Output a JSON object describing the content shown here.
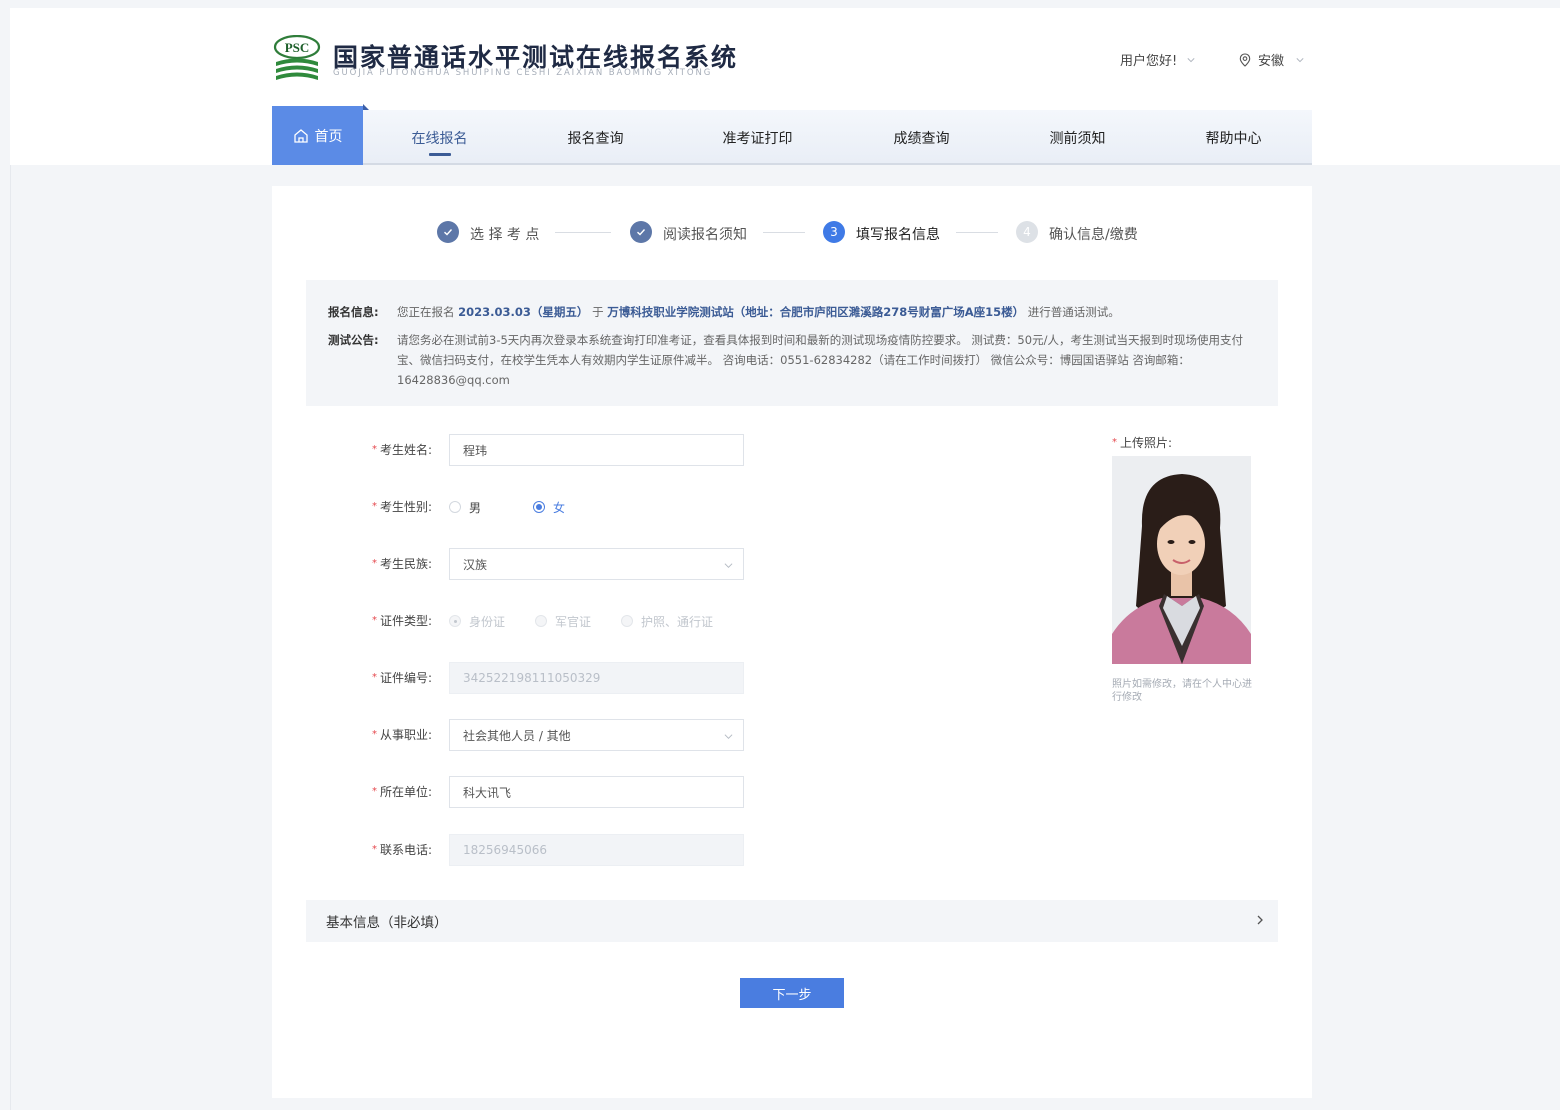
{
  "header": {
    "title": "国家普通话水平测试在线报名系统",
    "subtitle": "GUOJIA PUTONGHUA SHUIPING CESHI ZAIXIAN BAOMING XITONG",
    "logo_text": "PSC",
    "user_greeting": "用户您好!",
    "location": "安徽"
  },
  "nav": {
    "home": "首页",
    "items": [
      "在线报名",
      "报名查询",
      "准考证打印",
      "成绩查询",
      "测前须知",
      "帮助中心"
    ]
  },
  "steps": [
    {
      "label": "选 择 考 点",
      "state": "done"
    },
    {
      "label": "阅读报名须知",
      "state": "done"
    },
    {
      "number": "3",
      "label": "填写报名信息",
      "state": "active"
    },
    {
      "number": "4",
      "label": "确认信息/缴费",
      "state": "pending"
    }
  ],
  "notice": {
    "info_label": "报名信息:",
    "info_prefix": "您正在报名",
    "info_date": "2023.03.03（星期五）",
    "info_mid": "于",
    "info_site": "万博科技职业学院测试站（地址：合肥市庐阳区濉溪路278号财富广场A座15楼）",
    "info_suffix": "进行普通话测试。",
    "announce_label": "测试公告:",
    "announce_text": "请您务必在测试前3-5天内再次登录本系统查询打印准考证，查看具体报到时间和最新的测试现场疫情防控要求。 测试费：50元/人，考生测试当天报到时现场使用支付宝、微信扫码支付，在校学生凭本人有效期内学生证原件减半。 咨询电话：0551-62834282（请在工作时间拨打） 微信公众号：博园国语驿站 咨询邮箱：16428836@qq.com"
  },
  "form": {
    "name_label": "考生姓名:",
    "name_value": "程玮",
    "gender_label": "考生性别:",
    "gender_options": [
      "男",
      "女"
    ],
    "gender_selected": "女",
    "ethnicity_label": "考生民族:",
    "ethnicity_value": "汉族",
    "id_type_label": "证件类型:",
    "id_type_options": [
      "身份证",
      "军官证",
      "护照、通行证"
    ],
    "id_number_label": "证件编号:",
    "id_number_value": "342522198111050329",
    "occupation_label": "从事职业:",
    "occupation_value": "社会其他人员 / 其他",
    "employer_label": "所在单位:",
    "employer_value": "科大讯飞",
    "phone_label": "联系电话:",
    "phone_value": "18256945066",
    "photo_label": "上传照片:",
    "photo_hint": "照片如需修改，请在个人中心进行修改"
  },
  "basic_info": "基本信息（非必填）",
  "next_button": "下一步",
  "colors": {
    "accent": "#4a7de0",
    "nav_home": "#5b8be6",
    "step_done": "#5d77a8",
    "required": "#e5484d"
  }
}
